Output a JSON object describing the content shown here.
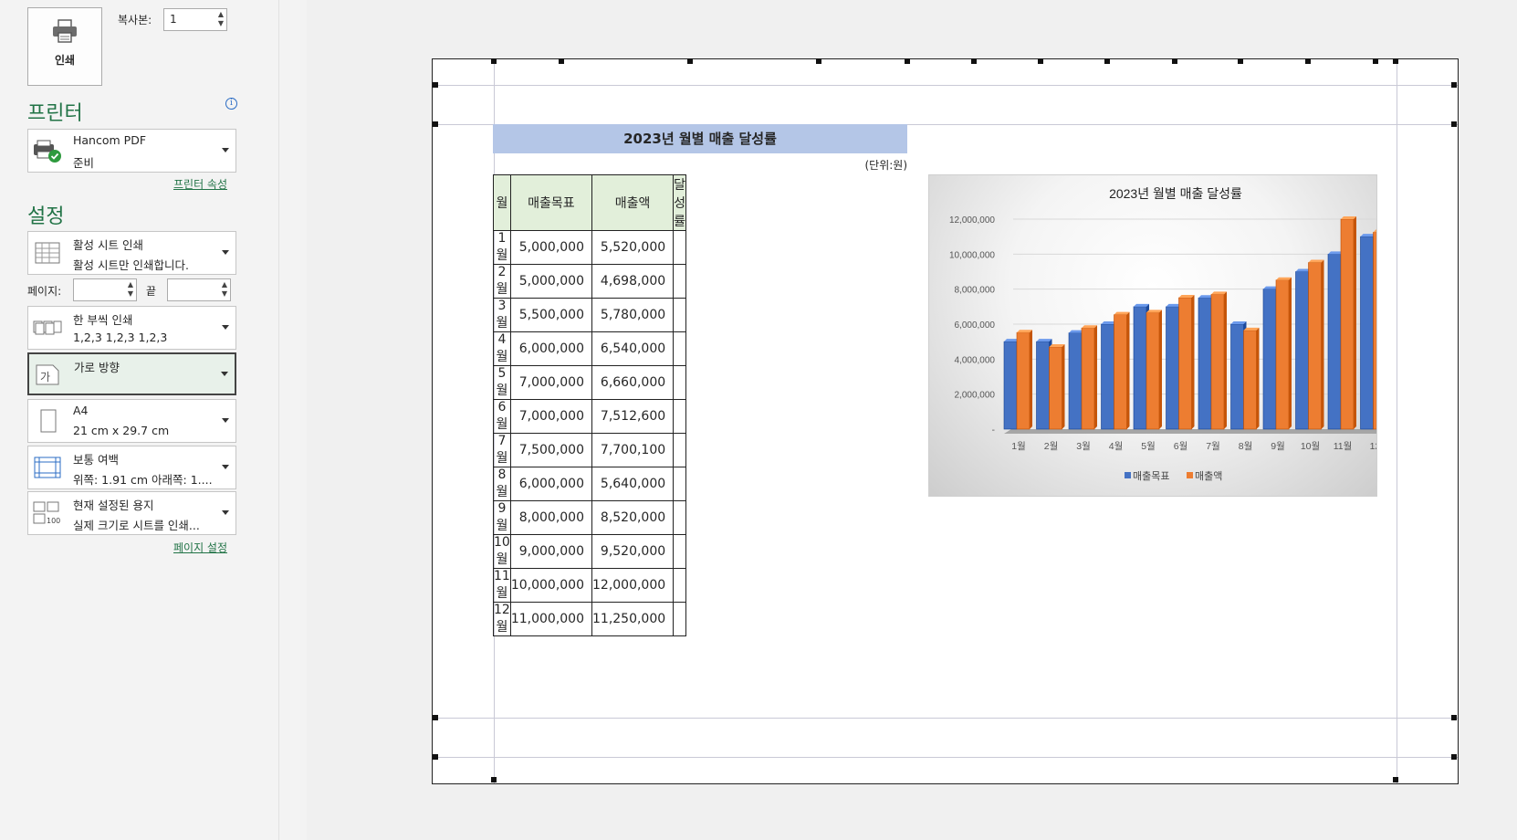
{
  "print_button": {
    "label": "인쇄"
  },
  "copies": {
    "label": "복사본:",
    "value": "1"
  },
  "printer": {
    "title": "프린터",
    "name": "Hancom PDF",
    "status": "준비",
    "properties_link": "프린터 속성"
  },
  "settings": {
    "title": "설정",
    "what_to_print": {
      "line1": "활성 시트 인쇄",
      "line2": "활성 시트만 인쇄합니다."
    },
    "pages": {
      "label": "페이지:",
      "to_label": "끝",
      "from_value": "",
      "to_value": ""
    },
    "collate": {
      "line1": "한 부씩 인쇄",
      "line2": "1,2,3     1,2,3     1,2,3"
    },
    "orientation": {
      "line1": "가로 방향",
      "icon_text": "가"
    },
    "paper": {
      "line1": "A4",
      "line2": "21 cm x 29.7 cm"
    },
    "margins": {
      "line1": "보통 여백",
      "line2": "위쪽: 1.91 cm 아래쪽: 1...."
    },
    "scaling": {
      "line1": "현재 설정된 용지",
      "line2": "실제 크기로 시트를 인쇄...",
      "icon_text": "100"
    },
    "page_setup_link": "페이지 설정"
  },
  "sheet": {
    "title": "2023년 월별 매출 달성률",
    "unit": "(단위:원)",
    "headers": [
      "월",
      "매출목표",
      "매출액",
      "달성률"
    ],
    "rows": [
      [
        "1월",
        "5,000,000",
        "5,520,000",
        ""
      ],
      [
        "2월",
        "5,000,000",
        "4,698,000",
        ""
      ],
      [
        "3월",
        "5,500,000",
        "5,780,000",
        ""
      ],
      [
        "4월",
        "6,000,000",
        "6,540,000",
        ""
      ],
      [
        "5월",
        "7,000,000",
        "6,660,000",
        ""
      ],
      [
        "6월",
        "7,000,000",
        "7,512,600",
        ""
      ],
      [
        "7월",
        "7,500,000",
        "7,700,100",
        ""
      ],
      [
        "8월",
        "6,000,000",
        "5,640,000",
        ""
      ],
      [
        "9월",
        "8,000,000",
        "8,520,000",
        ""
      ],
      [
        "10월",
        "9,000,000",
        "9,520,000",
        ""
      ],
      [
        "11월",
        "10,000,000",
        "12,000,000",
        ""
      ],
      [
        "12월",
        "11,000,000",
        "11,250,000",
        ""
      ]
    ]
  },
  "chart_data": {
    "type": "bar",
    "title": "2023년 월별 매출 달성률",
    "categories": [
      "1월",
      "2월",
      "3월",
      "4월",
      "5월",
      "6월",
      "7월",
      "8월",
      "9월",
      "10월",
      "11월",
      "12"
    ],
    "series": [
      {
        "name": "매출목표",
        "color": "#4472c4",
        "values": [
          5000000,
          5000000,
          5500000,
          6000000,
          7000000,
          7000000,
          7500000,
          6000000,
          8000000,
          9000000,
          10000000,
          11000000
        ]
      },
      {
        "name": "매출액",
        "color": "#ed7d31",
        "values": [
          5520000,
          4698000,
          5780000,
          6540000,
          6660000,
          7512600,
          7700100,
          5640000,
          8520000,
          9520000,
          12000000,
          11250000
        ]
      }
    ],
    "yticks": [
      "-",
      "2,000,000",
      "4,000,000",
      "6,000,000",
      "8,000,000",
      "10,000,000",
      "12,000,000"
    ],
    "ylim": [
      0,
      12000000
    ],
    "legend": "bottom",
    "grid": true
  }
}
